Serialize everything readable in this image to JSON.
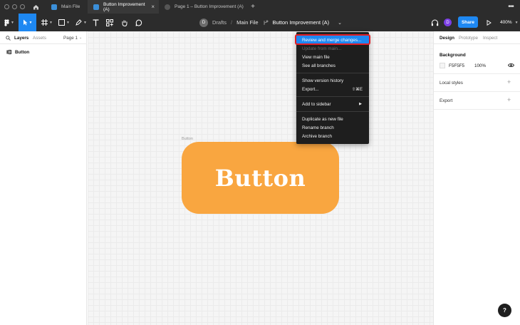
{
  "tabbar": {
    "tabs": [
      {
        "label": "Main File",
        "active": false
      },
      {
        "label": "Button Improvement (A)",
        "active": true
      },
      {
        "label": "Page 1 – Button Improvement (A)",
        "active": false
      }
    ],
    "close_glyph": "×",
    "new_tab_glyph": "+",
    "more_glyph": "•••"
  },
  "toolbar": {
    "breadcrumb": {
      "avatar_initial": "D",
      "team": "Drafts",
      "separator": "/",
      "file": "Main File",
      "branch": "Button Improvement (A)",
      "chevron": "⌄"
    },
    "user_initial": "D",
    "share_label": "Share",
    "zoom_label": "400%",
    "accent_color": "#1e88f2"
  },
  "left_panel": {
    "tabs": [
      "Layers",
      "Assets"
    ],
    "page_label": "Page 1",
    "layers": [
      {
        "name": "Button",
        "icon": "component-icon"
      }
    ]
  },
  "canvas": {
    "frame_label": "Button",
    "button_text": "Button",
    "button_color": "#f9a640"
  },
  "right_panel": {
    "tabs": [
      "Design",
      "Prototype",
      "Inspect"
    ],
    "background": {
      "title": "Background",
      "hex": "F5F5F5",
      "opacity": "100%"
    },
    "local_styles": "Local styles",
    "export": "Export",
    "plus_glyph": "+"
  },
  "menu": {
    "items": [
      {
        "label": "Review and merge changes...",
        "state": "highlighted"
      },
      {
        "label": "Update from main...",
        "state": "disabled"
      },
      {
        "label": "View main file"
      },
      {
        "label": "See all branches"
      },
      {
        "label": "Show version history"
      },
      {
        "label": "Export...",
        "shortcut": "⇧⌘E"
      },
      {
        "label": "Add to sidebar",
        "submenu": "▶"
      },
      {
        "label": "Duplicate as new file"
      },
      {
        "label": "Rename branch"
      },
      {
        "label": "Archive branch"
      }
    ],
    "highlight_color": "#1e88f2",
    "annotation_color": "#e21d25"
  },
  "help": {
    "label": "?"
  }
}
